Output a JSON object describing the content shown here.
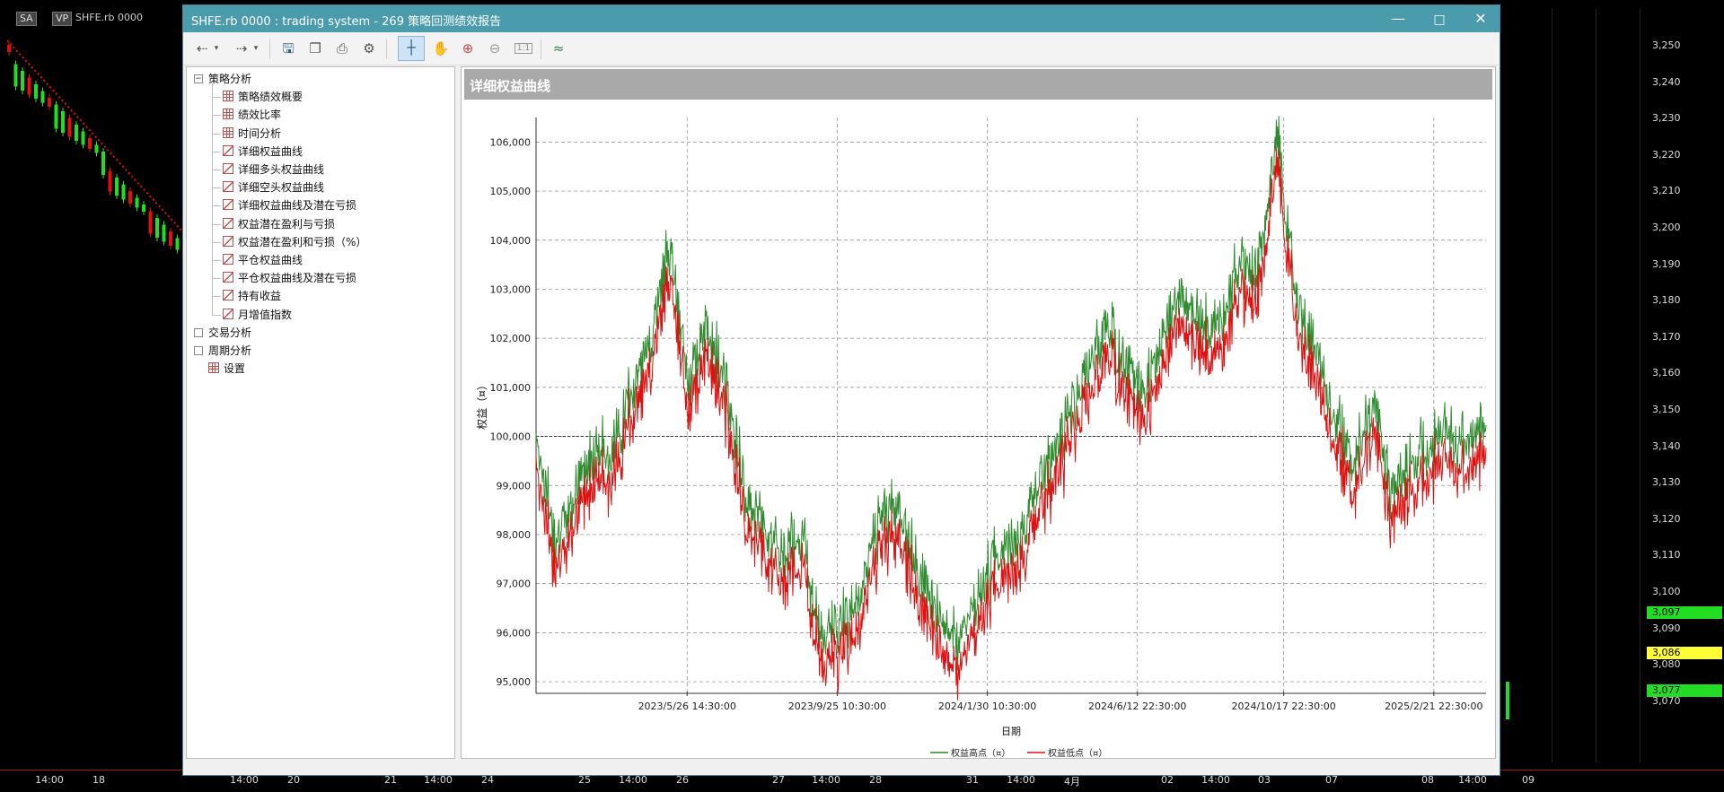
{
  "background": {
    "mode_label": "SA",
    "vp_label": "VP",
    "symbol": "SHFE.rb 0000",
    "price_ticks": [
      "3,250",
      "3,240",
      "3,230",
      "3,220",
      "3,210",
      "3,200",
      "3,190",
      "3,180",
      "3,170",
      "3,160",
      "3,150",
      "3,140",
      "3,130",
      "3,120",
      "3,110",
      "3,100",
      "3,090",
      "3,080",
      "3,070"
    ],
    "price_tags": [
      {
        "value": "3,097",
        "color": "#22dd22"
      },
      {
        "value": "3,086",
        "color": "#ffff33"
      },
      {
        "value": "3,077",
        "color": "#22dd22"
      }
    ],
    "time_labels": [
      "14:00",
      "18",
      "14:00",
      "20",
      "21",
      "14:00",
      "24",
      "25",
      "14:00",
      "26",
      "27",
      "14:00",
      "28",
      "31",
      "14:00",
      "4月",
      "02",
      "14:00",
      "03",
      "07",
      "08",
      "14:00",
      "09"
    ]
  },
  "window": {
    "title": "SHFE.rb 0000 : trading system - 269 策略回测绩效报告",
    "minimize_icon": "minimize-icon",
    "maximize_icon": "maximize-icon",
    "close_icon": "close-icon"
  },
  "toolbar": {
    "buttons": [
      "back-icon",
      "dropdown-icon",
      "forward-icon",
      "dropdown-icon",
      "save-icon",
      "copy-icon",
      "print-icon",
      "settings-icon",
      "crosshair-icon",
      "hand-pan-icon",
      "zoom-in-icon",
      "zoom-out-icon",
      "zoom-reset-icon",
      "chart-style-icon"
    ],
    "zoom_reset_label": "1:1"
  },
  "tree": {
    "groups": [
      {
        "label": "策略分析",
        "expanded": true,
        "items": [
          "策略绩效概要",
          "绩效比率",
          "时间分析",
          "详细权益曲线",
          "详细多头权益曲线",
          "详细空头权益曲线",
          "详细权益曲线及潜在亏损",
          "权益潜在盈利与亏损",
          "权益潜在盈利和亏损（%）",
          "平仓权益曲线",
          "平仓权益曲线及潜在亏损",
          "持有收益",
          "月增值指数"
        ]
      },
      {
        "label": "交易分析",
        "expanded": false,
        "items": []
      },
      {
        "label": "周期分析",
        "expanded": false,
        "items": []
      },
      {
        "label": "设置",
        "expanded": false,
        "items": []
      }
    ],
    "selected": "详细权益曲线"
  },
  "report": {
    "title": "详细权益曲线"
  },
  "chart_data": {
    "type": "line",
    "title": "",
    "xlabel": "日期",
    "ylabel": "权益（¤）",
    "ylim": [
      94800,
      106500
    ],
    "y_ticks": [
      "95,000",
      "96,000",
      "97,000",
      "98,000",
      "99,000",
      "100,000",
      "101,000",
      "102,000",
      "103,000",
      "104,000",
      "105,000",
      "106,000"
    ],
    "x_ticks": [
      "2023/5/26 14:30:00",
      "2023/9/25 10:30:00",
      "2024/1/30 10:30:00",
      "2024/6/12 22:30:00",
      "2024/10/17 22:30:00",
      "2025/2/21 22:30:00"
    ],
    "grid": true,
    "reference_line": 100000,
    "legend_position": "bottom",
    "series": [
      {
        "name": "权益高点（¤）",
        "color": "#2e8b2e"
      },
      {
        "name": "权益低点（¤）",
        "color": "#dd1111"
      }
    ],
    "x": [
      0,
      0.02,
      0.04,
      0.06,
      0.08,
      0.1,
      0.12,
      0.14,
      0.16,
      0.18,
      0.2,
      0.22,
      0.24,
      0.26,
      0.28,
      0.3,
      0.32,
      0.34,
      0.36,
      0.38,
      0.4,
      0.42,
      0.44,
      0.46,
      0.48,
      0.5,
      0.52,
      0.54,
      0.56,
      0.58,
      0.6,
      0.62,
      0.64,
      0.66,
      0.68,
      0.7,
      0.72,
      0.74,
      0.76,
      0.78,
      0.8,
      0.82,
      0.84,
      0.86,
      0.88,
      0.9,
      0.92,
      0.94,
      0.96,
      0.98,
      1.0
    ],
    "values": [
      99800,
      97600,
      98400,
      99500,
      99300,
      100600,
      101500,
      103600,
      100800,
      101900,
      100800,
      98500,
      97800,
      97200,
      97800,
      95500,
      95900,
      96300,
      98000,
      98300,
      97100,
      96200,
      95400,
      96200,
      97100,
      97500,
      98200,
      99200,
      100000,
      101000,
      102000,
      101300,
      100500,
      101800,
      102600,
      101900,
      102000,
      103200,
      103000,
      105800,
      102600,
      101400,
      100200,
      99100,
      100400,
      98600,
      99100,
      99500,
      99700,
      99600,
      99900
    ]
  }
}
